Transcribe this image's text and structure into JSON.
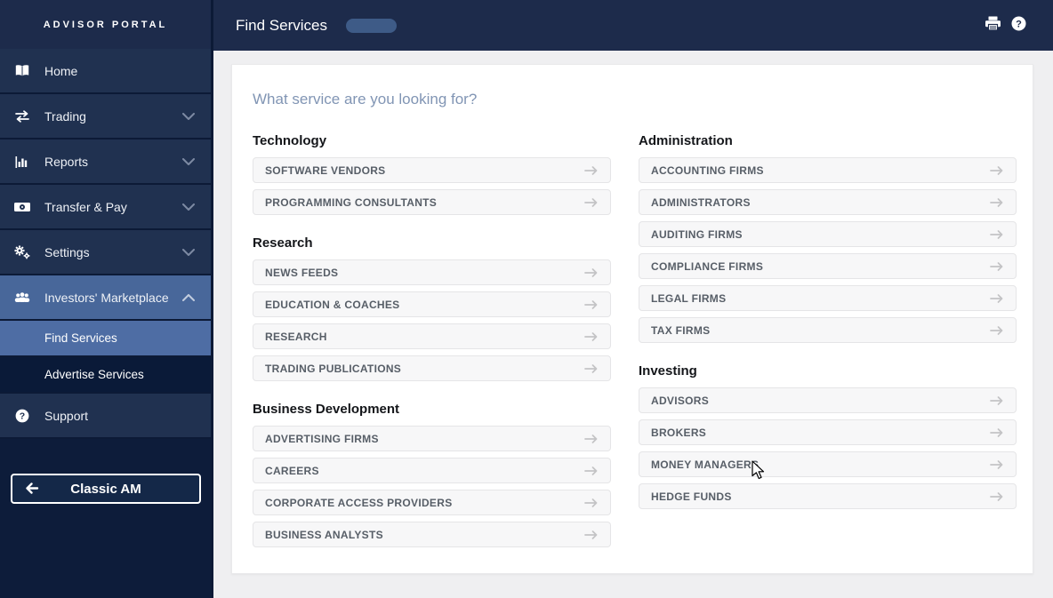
{
  "colors": {
    "topbar_bg": "#1d2b4b",
    "sidebar_item_bg": "#203150",
    "sidebar_divider": "#0c1a36",
    "sidebar_selected_bg": "#48679a",
    "sidebar_active_sub_bg": "#4e6da4",
    "sidebar_dark_sub_bg": "#0a1a38",
    "sidebar_bottom_bg": "#0d1c3a",
    "content_bg": "#efeff1",
    "card_bg": "#ffffff",
    "heading_color": "#8195b4",
    "button_bg": "#f7f7f8",
    "button_border": "#e5e5e7",
    "button_text": "#575e67",
    "arrow_color": "#c3c3c5",
    "badge_bg": "#3e5b87"
  },
  "sidebar": {
    "brand": "ADVISOR PORTAL",
    "items": [
      {
        "label": "Home",
        "icon": "book-icon",
        "chevron": "none"
      },
      {
        "label": "Trading",
        "icon": "swap-arrows-icon",
        "chevron": "down"
      },
      {
        "label": "Reports",
        "icon": "bar-chart-icon",
        "chevron": "down"
      },
      {
        "label": "Transfer & Pay",
        "icon": "banknote-icon",
        "chevron": "down"
      },
      {
        "label": "Settings",
        "icon": "gears-icon",
        "chevron": "down"
      },
      {
        "label": "Investors' Marketplace",
        "icon": "people-icon",
        "chevron": "up",
        "state": "expanded-selected"
      }
    ],
    "sub_items": [
      {
        "label": "Find Services",
        "state": "active"
      },
      {
        "label": "Advertise Services",
        "state": "default"
      }
    ],
    "support": {
      "label": "Support",
      "icon": "question-icon"
    },
    "back_button": {
      "label": "Classic AM",
      "icon": "arrow-left-icon"
    }
  },
  "topbar": {
    "title": "Find Services",
    "badge": "",
    "icons": [
      "printer-icon",
      "help-icon"
    ]
  },
  "main": {
    "heading": "What service are you looking for?",
    "columns": [
      {
        "sections": [
          {
            "title": "Technology",
            "items": [
              "SOFTWARE VENDORS",
              "PROGRAMMING CONSULTANTS"
            ]
          },
          {
            "title": "Research",
            "items": [
              "NEWS FEEDS",
              "EDUCATION & COACHES",
              "RESEARCH",
              "TRADING PUBLICATIONS"
            ]
          },
          {
            "title": "Business Development",
            "items": [
              "ADVERTISING FIRMS",
              "CAREERS",
              "CORPORATE ACCESS PROVIDERS",
              "BUSINESS ANALYSTS"
            ]
          }
        ]
      },
      {
        "sections": [
          {
            "title": "Administration",
            "items": [
              "ACCOUNTING FIRMS",
              "ADMINISTRATORS",
              "AUDITING FIRMS",
              "COMPLIANCE FIRMS",
              "LEGAL FIRMS",
              "TAX FIRMS"
            ]
          },
          {
            "title": "Investing",
            "items": [
              "ADVISORS",
              "BROKERS",
              "MONEY MANAGERS",
              "HEDGE FUNDS"
            ]
          }
        ]
      }
    ]
  }
}
